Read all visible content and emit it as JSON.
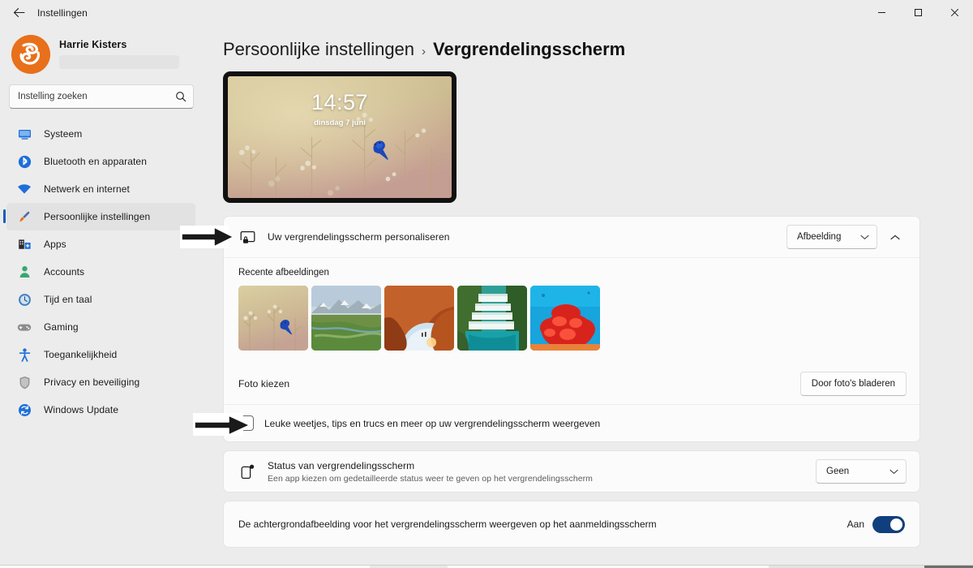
{
  "window": {
    "title": "Instellingen",
    "back_icon": "back-arrow-icon",
    "minimize_label": "—",
    "maximize_label": "▢",
    "close_label": "✕"
  },
  "sidebar": {
    "profile": {
      "name": "Harrie Kisters",
      "email_masked": ""
    },
    "search": {
      "placeholder": "Instelling zoeken",
      "icon": "search-icon"
    },
    "items": [
      {
        "label": "Systeem",
        "icon": "monitor-icon",
        "selected": false
      },
      {
        "label": "Bluetooth en apparaten",
        "icon": "bluetooth-icon",
        "selected": false
      },
      {
        "label": "Netwerk en internet",
        "icon": "wifi-icon",
        "selected": false
      },
      {
        "label": "Persoonlijke instellingen",
        "icon": "paintbrush-icon",
        "selected": true
      },
      {
        "label": "Apps",
        "icon": "apps-icon",
        "selected": false
      },
      {
        "label": "Accounts",
        "icon": "person-icon",
        "selected": false
      },
      {
        "label": "Tijd en taal",
        "icon": "clock-icon",
        "selected": false
      },
      {
        "label": "Gaming",
        "icon": "gamepad-icon",
        "selected": false
      },
      {
        "label": "Toegankelijkheid",
        "icon": "accessibility-icon",
        "selected": false
      },
      {
        "label": "Privacy en beveiliging",
        "icon": "shield-icon",
        "selected": false
      },
      {
        "label": "Windows Update",
        "icon": "update-icon",
        "selected": false
      }
    ]
  },
  "breadcrumb": {
    "parent": "Persoonlijke instellingen",
    "separator": "›",
    "current": "Vergrendelingsscherm"
  },
  "preview": {
    "time": "14:57",
    "date": "dinsdag 7 juni",
    "alt": "Blauwe vogel op tak in vervaagde weide"
  },
  "personalize": {
    "icon": "lock-screen-icon",
    "title": "Uw vergrendelingsscherm personaliseren",
    "dropdown_value": "Afbeelding",
    "dropdown_icon": "chevron-down-icon",
    "expander_icon": "chevron-up-icon",
    "recent_label": "Recente afbeeldingen",
    "thumbnails": [
      {
        "name": "vogel-in-weide",
        "colors": [
          "#c9b68b",
          "#d8c79c"
        ]
      },
      {
        "name": "berglandschap-vallei",
        "colors": [
          "#9fb6c4",
          "#6f8f4f"
        ]
      },
      {
        "name": "rode-rotsboog",
        "colors": [
          "#b5501e",
          "#d9772f"
        ]
      },
      {
        "name": "watervallen-terrassen",
        "colors": [
          "#2f9f96",
          "#1f7d6e"
        ]
      },
      {
        "name": "rood-koraal-onderwater",
        "colors": [
          "#1ea3d8",
          "#d8251f"
        ]
      }
    ],
    "choose_photo_label": "Foto kiezen",
    "browse_button": "Door foto's bladeren",
    "tips_checkbox_label": "Leuke weetjes, tips en trucs en meer op uw vergrendelingsscherm weergeven",
    "tips_checked": false
  },
  "status": {
    "icon": "status-badge-icon",
    "title": "Status van vergrendelingsscherm",
    "subtitle": "Een app kiezen om gedetailleerde status weer te geven op het vergrendelingsscherm",
    "dropdown_value": "Geen",
    "dropdown_icon": "chevron-down-icon"
  },
  "signin_background": {
    "label": "De achtergrondafbeelding voor het vergrendelingsscherm weergeven op het aanmeldingsscherm",
    "state_label": "Aan",
    "enabled": true
  },
  "annotations": [
    {
      "name": "arrow-to-personalize-row",
      "target": "Uw vergrendelingsscherm personaliseren"
    },
    {
      "name": "arrow-to-tips-checkbox",
      "target": "Leuke weetjes, tips en trucs checkbox"
    }
  ],
  "colors": {
    "accent": "#0f5ec0",
    "toggle_on": "#103f7d",
    "window_bg": "#ececec",
    "card_bg": "#fbfbfb",
    "avatar_orange": "#e8701b"
  }
}
